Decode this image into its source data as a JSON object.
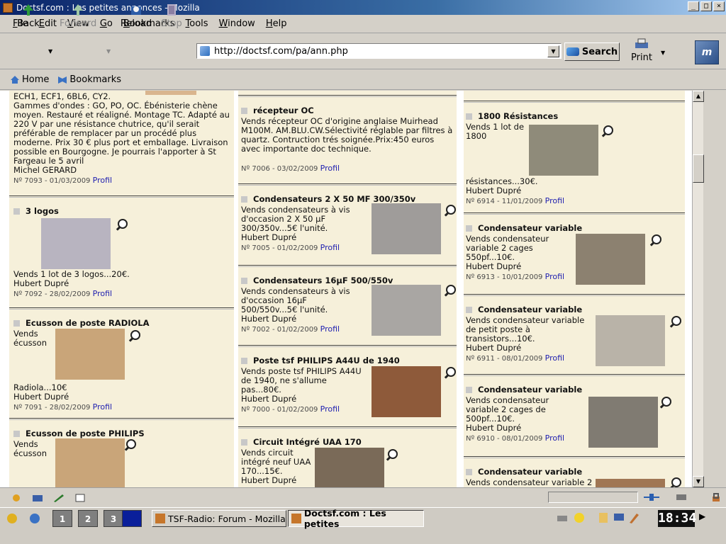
{
  "window": {
    "title": "Doctsf.com : Les petites annonces - Mozilla"
  },
  "menu": [
    "File",
    "Edit",
    "View",
    "Go",
    "Bookmarks",
    "Tools",
    "Window",
    "Help"
  ],
  "nav": {
    "back": "Back",
    "forward": "Forward",
    "reload": "Reload",
    "stop": "Stop",
    "url": "http://doctsf.com/pa/ann.php",
    "search": "Search",
    "print": "Print"
  },
  "personal": {
    "home": "Home",
    "bookmarks": "Bookmarks"
  },
  "profil_label": "Profil",
  "col1": {
    "top_title_tail": "ECH1, ECF1, 6BL6, CY2.",
    "top_desc": "Gammes d'ondes : GO, PO, OC. Ébénisterie chène moyen. Restauré et réaligné. Montage TC. Adapté au 220 V par une résistance chutrice, qu'il serait préférable de remplacer par un procédé plus moderne. Prix 30 € plus port et emballage. Livraison possible en Bourgogne. Je pourrais l'apporter à St Fargeau le 5 avril",
    "top_author": "Michel GERARD",
    "top_meta": "Nº 7093 - 01/03/2009",
    "ads": [
      {
        "title": "3 logos",
        "desc": "Vends 1 lot de 3 logos...20€.",
        "author": "Hubert Dupré",
        "meta": "Nº 7092 - 28/02/2009"
      },
      {
        "title": "Ecusson de poste RADIOLA",
        "desc_a": "Vends",
        "desc_b": "écusson",
        "desc_c": "Radiola...10€",
        "author": "Hubert Dupré",
        "meta": "Nº 7091 - 28/02/2009"
      },
      {
        "title": "Ecusson de poste PHILIPS",
        "desc_a": "Vends",
        "desc_b": "écusson"
      }
    ]
  },
  "col2": {
    "ads": [
      {
        "title": "récepteur OC",
        "desc": "Vends récepteur OC d'origine anglaise Muirhead M100M. AM.BLU.CW.Sélectivité réglable par filtres à quartz. Contruction trés soignée.Prix:450 euros avec importante doc technique.",
        "meta": "Nº 7006 - 03/02/2009"
      },
      {
        "title": "Condensateurs 2 X 50 MF 300/350v",
        "desc": "Vends condensateurs à vis d'occasion 2 X 50 µF 300/350v...5€ l'unité.",
        "author": "Hubert Dupré",
        "meta": "Nº 7005 - 01/02/2009"
      },
      {
        "title": "Condensateurs 16µF 500/550v",
        "desc": "Vends condensateurs à vis d'occasion 16µF 500/550v...5€ l'unité.",
        "author": "Hubert Dupré",
        "meta": "Nº 7002 - 01/02/2009"
      },
      {
        "title": "Poste tsf PHILIPS A44U de 1940",
        "desc": "Vends poste tsf PHILIPS A44U de 1940, ne s'allume pas...80€.",
        "author": "Hubert Dupré",
        "meta": "Nº 7000 - 01/02/2009"
      },
      {
        "title": "Circuit Intégré UAA 170",
        "desc": "Vends circuit intégré neuf UAA 170...15€.",
        "author": "Hubert Dupré"
      }
    ]
  },
  "col3": {
    "ads": [
      {
        "title": "1800 Résistances",
        "desc_a": "Vends 1 lot de",
        "desc_b": "1800",
        "desc_c": "résistances...30€.",
        "author": "Hubert Dupré",
        "meta": "Nº 6914 - 11/01/2009"
      },
      {
        "title": "Condensateur variable",
        "desc": "Vends condensateur variable 2 cages 550pf...10€.",
        "author": "Hubert Dupré",
        "meta": "Nº 6913 - 10/01/2009"
      },
      {
        "title": "Condensateur variable",
        "desc": "Vends condensateur variable de petit poste à transistors...10€.",
        "author": "Hubert Dupré",
        "meta": "Nº 6911 - 08/01/2009"
      },
      {
        "title": "Condensateur variable",
        "desc": "Vends condensateur variable 2 cages de 500pf...10€.",
        "author": "Hubert Dupré",
        "meta": "Nº 6910 - 08/01/2009"
      },
      {
        "title": "Condensateur variable",
        "desc": "Vends condensateur variable 2"
      }
    ]
  },
  "taskbar": {
    "desktops": [
      "1",
      "2",
      "3"
    ],
    "tasks": [
      "TSF-Radio: Forum - Mozilla",
      "Doctsf.com : Les petites"
    ],
    "clock": "18:34"
  }
}
